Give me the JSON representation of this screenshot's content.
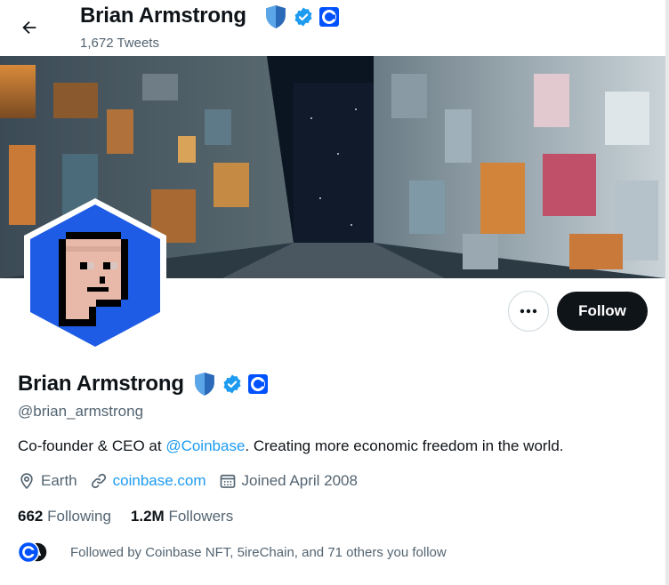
{
  "header": {
    "name": "Brian Armstrong",
    "tweet_count": "1,672 Tweets"
  },
  "profile": {
    "name": "Brian Armstrong",
    "handle": "@brian_armstrong",
    "bio_prefix": "Co-founder & CEO at ",
    "bio_mention": "@Coinbase",
    "bio_suffix": ". Creating more economic freedom in the world.",
    "location": "Earth",
    "website": "coinbase.com",
    "joined": "Joined April 2008"
  },
  "stats": {
    "following_count": "662",
    "following_label": "Following",
    "followers_count": "1.2M",
    "followers_label": "Followers"
  },
  "followed_by": "Followed by Coinbase NFT, 5ireChain, and 71 others you follow",
  "actions": {
    "follow_label": "Follow"
  },
  "icons": {
    "back": "arrow-left-icon",
    "shield": "shield-badge-icon",
    "verified": "verified-badge-icon",
    "affiliate": "coinbase-affiliate-icon",
    "more": "more-dots-icon",
    "location": "location-pin-icon",
    "link": "link-icon",
    "calendar": "calendar-icon"
  },
  "colors": {
    "accent": "#1d9bf0",
    "follow_button": "#0f1419",
    "avatar_bg": "#1e5ce6",
    "coinbase_blue": "#0052ff"
  }
}
